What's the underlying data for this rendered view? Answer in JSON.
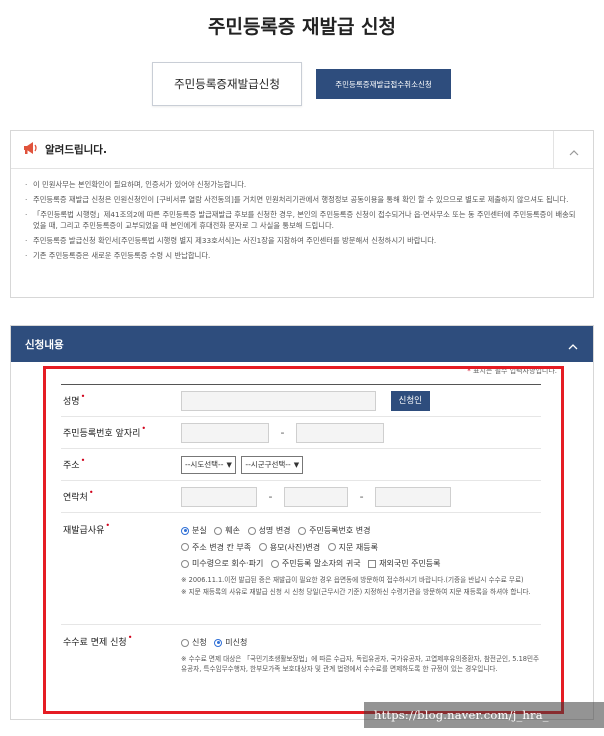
{
  "page": {
    "title": "주민등록증 재발급 신청"
  },
  "tabs": {
    "active": "주민등록증재발급신청",
    "other": "주민등록증재발급접수취소신청"
  },
  "notice": {
    "title": "알려드립니다.",
    "items": [
      "이 민원사무는 본인확인이 필요하며, 인증서가 있어야 신청가능합니다.",
      "주민등록증 재발급 신청은 민원신청인이 [구비서류 열람 사전동의]를 거치면 민원처리기관에서 행정정보 공동이용을 통해 확인 할 수 있으므로 별도로 제출하지 않으셔도 됩니다.",
      "「주민등록법 시행령」제41조의2에 따른 주민등록증 발급재발급 후보를 신청한 경우, 본인의 주민등록증 신청이 접수되거나 읍·면사무소 또는 동 주민센터에 주민등록증이 배송되었을 때, 그리고 주민등록증이 교부되었을 때 본인에게 휴대전화 문자로 그 사실을 통보해 드립니다.",
      "주민등록증 발급신청 확인서[주민등록법 시행령 별지 제33호서식]는 사진1장을 지참하여 주민센터를 방문해서 신청하시기 바랍니다.",
      "기존 주민등록증은 새로운 주민등록증 수령 시 반납합니다."
    ]
  },
  "section": {
    "title": "신청내용",
    "required_note": "표시는 필수 입력사항입니다.",
    "name_label": "성명",
    "auth_button": "신청인",
    "rrn_label": "주민등록번호 앞자리",
    "address_label": "주소",
    "sido_select": "--시도선택--",
    "sigungu_select": "--시군구선택--",
    "phone_label": "연락처",
    "reason_label": "재발급사유",
    "reasons": [
      "분실",
      "훼손",
      "성명 변경",
      "주민등록번호 변경",
      "주소 변경 칸 부족",
      "용모(사진)변경",
      "지문 재등록",
      "미수령으로 회수·파기",
      "주민등록 말소자의 귀국",
      "재외국민 주민등록"
    ],
    "reason_note1": "※ 2006.11.1.이전 발급된 증은 재발급이 필요한 경우 읍면동에 방문하여 접수하시기 바랍니다.(기증을 반납시 수수료 무료)",
    "reason_note2": "※ 지문 재등록의 사유로 재발급 신청 시 신청 당일(근무시간 기준) 지정하신 수령기관을 방문하여 지문 재등록을 하셔야 합니다.",
    "fee_label": "수수료 면제 신청",
    "fee_options": [
      "신청",
      "미신청"
    ],
    "fee_note": "※ 수수료 면제 대상은 「국민기초생활보장법」에 따른 수급자, 독립유공자, 국가유공자, 고엽제후유의증환자, 참전군인, 5.18민주유공자, 특수임무수행자, 한부모가족 보호대상자 및 관계 법령에서 수수료를 면제하도록 한 규정이 있는 경우입니다."
  },
  "watermark": "https://blog.naver.com/j_hra_",
  "colors": {
    "navy": "#2e4d7d",
    "required": "#d0021b",
    "highlight": "#e51c23"
  }
}
